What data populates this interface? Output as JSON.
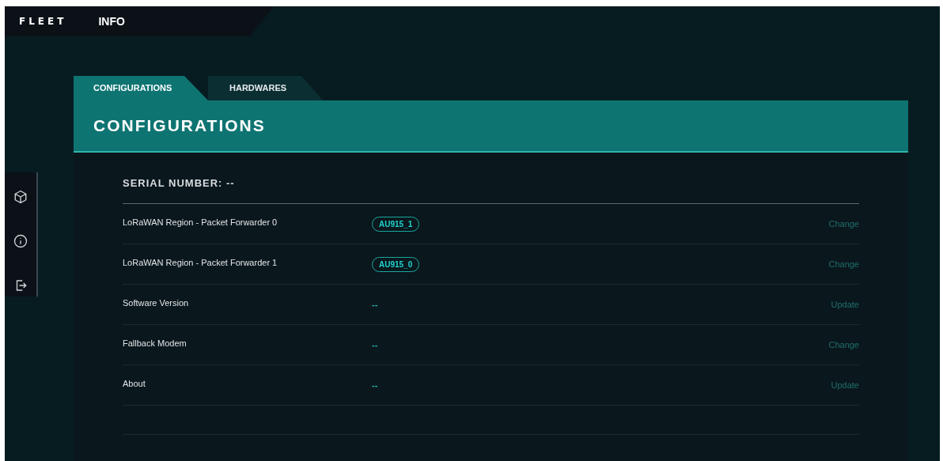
{
  "header": {
    "logo": "FLEET",
    "title": "INFO"
  },
  "tabs": [
    {
      "label": "CONFIGURATIONS",
      "selected": true
    },
    {
      "label": "HARDWARES",
      "selected": false
    }
  ],
  "panel": {
    "title": "CONFIGURATIONS",
    "serial_number": "SERIAL NUMBER: --",
    "rows": [
      {
        "label": "LoRaWAN Region - Packet Forwarder 0",
        "kind": "badge",
        "value": "AU915_1",
        "action": "Change"
      },
      {
        "label": "LoRaWAN Region - Packet Forwarder 1",
        "kind": "badge",
        "value": "AU915_0",
        "action": "Change"
      },
      {
        "label": "Software Version",
        "kind": "text",
        "value": "--",
        "action": "Update"
      },
      {
        "label": "Fallback Modem",
        "kind": "text",
        "value": "--",
        "action": "Change"
      },
      {
        "label": "About",
        "kind": "text",
        "value": "--",
        "action": "Update"
      }
    ]
  }
}
